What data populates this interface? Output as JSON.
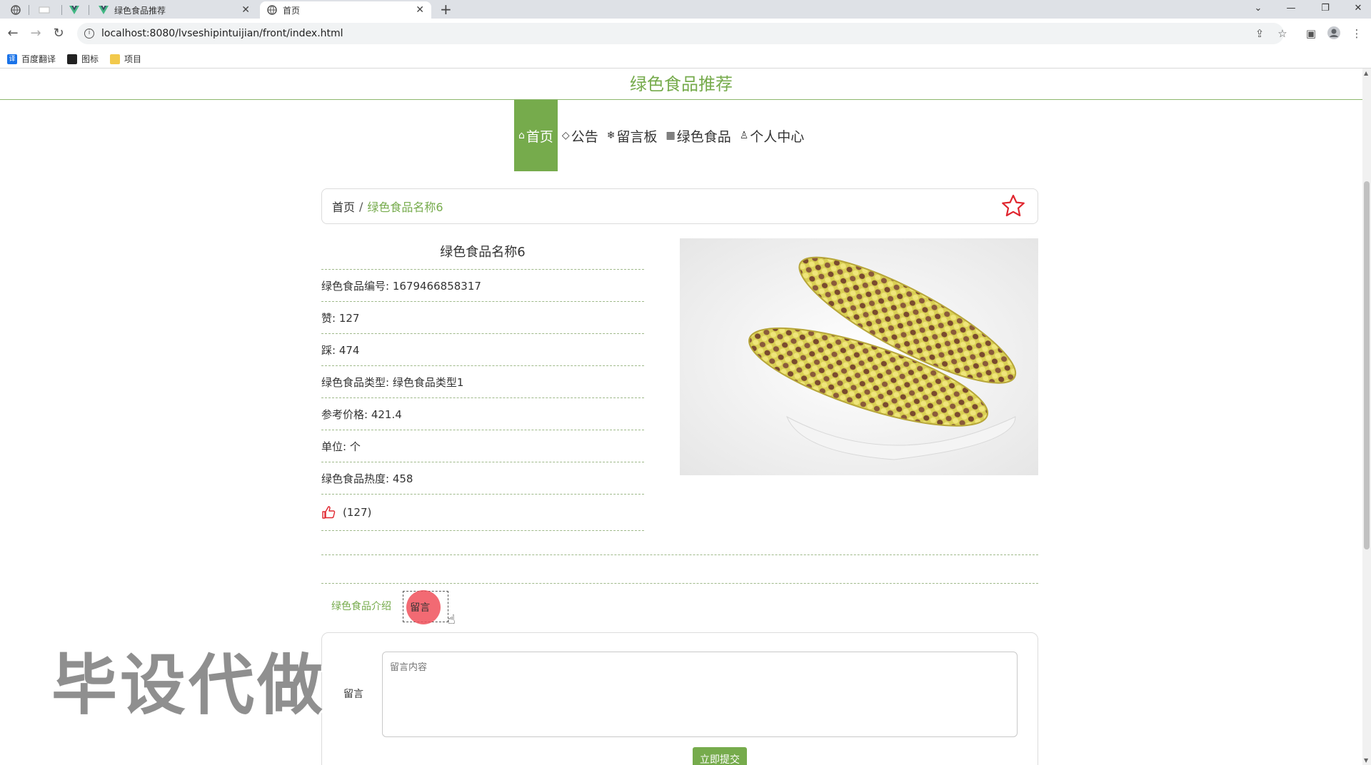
{
  "browser": {
    "tabs": [
      {
        "title": "绿色食品推荐",
        "active": false
      },
      {
        "title": "首页",
        "active": true
      }
    ],
    "url": "localhost:8080/lvseshipintuijian/front/index.html",
    "bookmarks": [
      {
        "label": "百度翻译",
        "icon": "translate-icon",
        "color": "#1a73e8"
      },
      {
        "label": "图标",
        "icon": "image-icon",
        "color": "#222222"
      },
      {
        "label": "项目",
        "icon": "folder-icon",
        "color": "#f2c94c"
      }
    ]
  },
  "site": {
    "title": "绿色食品推荐",
    "accent": "#76ab4c",
    "nav": [
      {
        "label": "首页",
        "icon": "home-icon",
        "glyph": "⌂",
        "active": true
      },
      {
        "label": "公告",
        "icon": "tag-icon",
        "glyph": "◇",
        "active": false
      },
      {
        "label": "留言板",
        "icon": "snowflake-icon",
        "glyph": "❄",
        "active": false
      },
      {
        "label": "绿色食品",
        "icon": "grid-icon",
        "glyph": "▦",
        "active": false
      },
      {
        "label": "个人中心",
        "icon": "user-icon",
        "glyph": "♙",
        "active": false
      }
    ]
  },
  "breadcrumb": {
    "home": "首页",
    "separator": "/",
    "current": "绿色食品名称6"
  },
  "product": {
    "name": "绿色食品名称6",
    "fields": [
      {
        "label": "绿色食品编号",
        "value": "1679466858317"
      },
      {
        "label": "赞",
        "value": "127"
      },
      {
        "label": "踩",
        "value": "474"
      },
      {
        "label": "绿色食品类型",
        "value": "绿色食品类型1"
      },
      {
        "label": "参考价格",
        "value": "421.4"
      },
      {
        "label": "单位",
        "value": "个"
      },
      {
        "label": "绿色食品热度",
        "value": "458"
      }
    ],
    "like_count": "(127)"
  },
  "detail_tabs": [
    {
      "label": "绿色食品介绍",
      "active": false
    },
    {
      "label": "留言",
      "active": true
    }
  ],
  "comment_form": {
    "label": "留言",
    "placeholder": "留言内容",
    "submit": "立即提交"
  },
  "watermark": "毕设代做"
}
